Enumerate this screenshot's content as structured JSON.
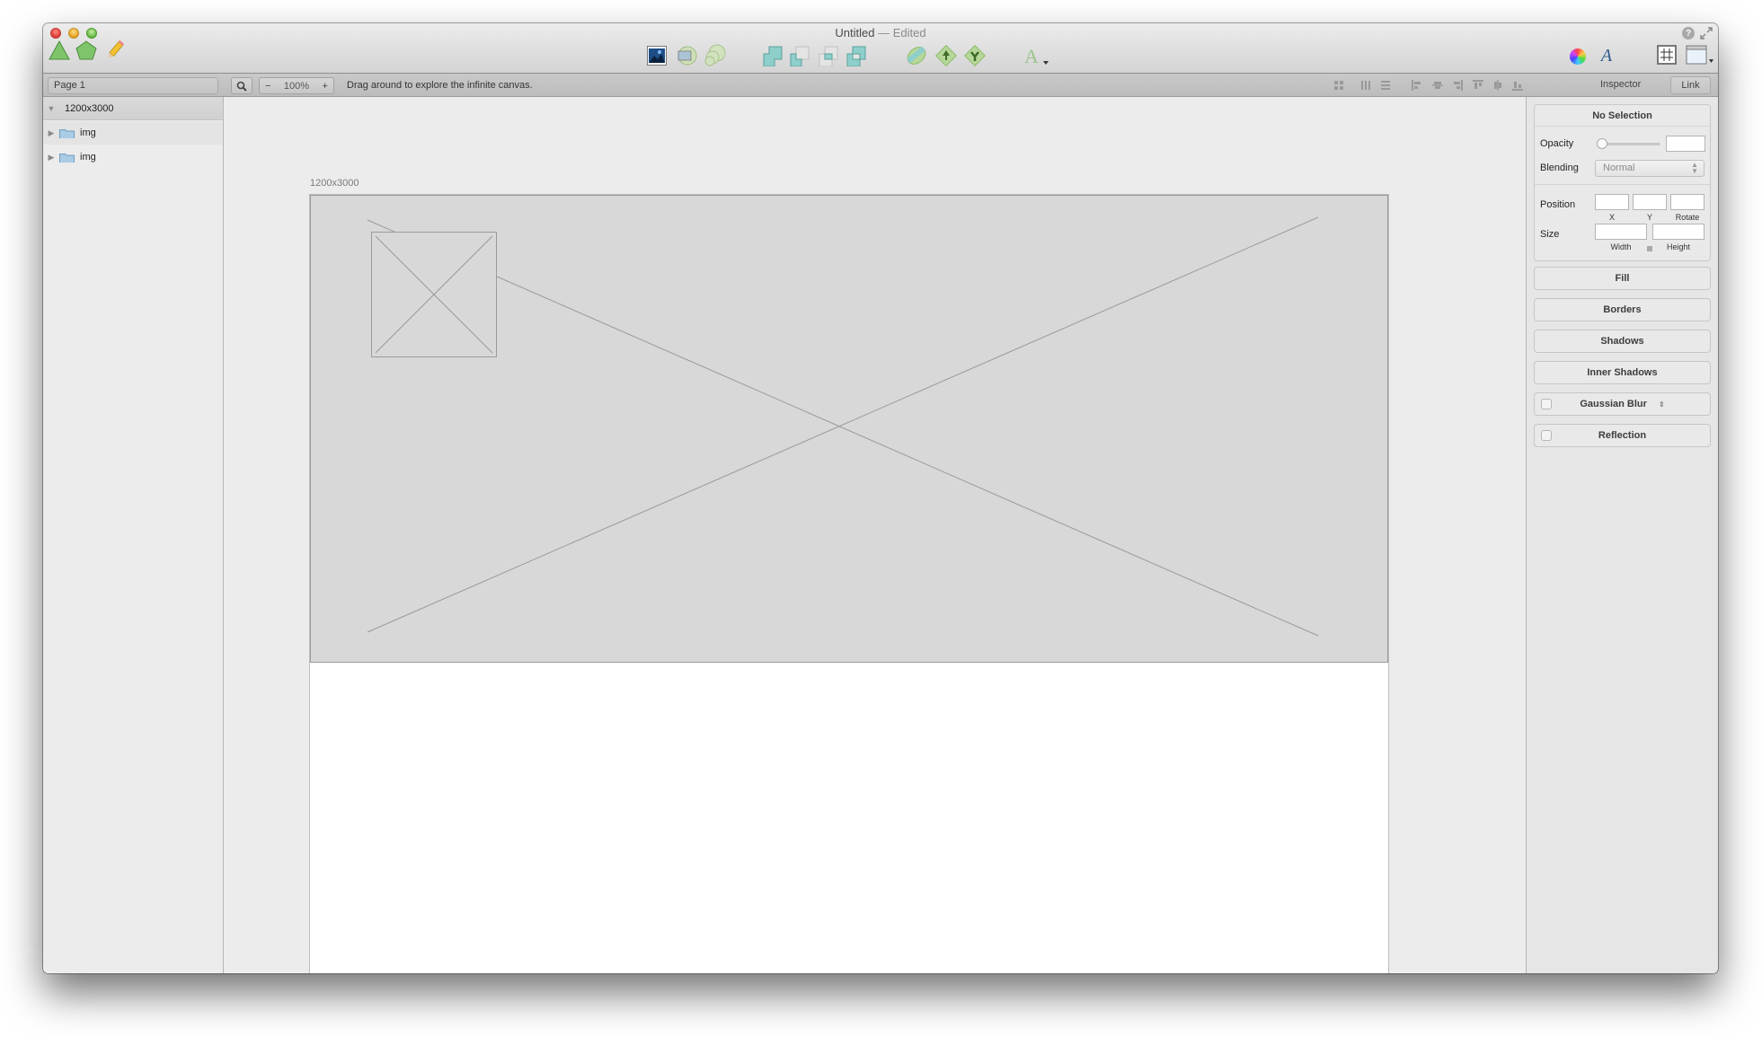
{
  "window": {
    "title": "Untitled",
    "title_separator": " — ",
    "title_status": "Edited"
  },
  "toolbar": {
    "left_tools": [
      {
        "name": "triangle-tool",
        "icon": "triangle-icon"
      },
      {
        "name": "polygon-tool",
        "icon": "pentagon-icon"
      },
      {
        "name": "pencil-tool",
        "icon": "pencil-icon"
      }
    ],
    "center_tools": [
      {
        "name": "image",
        "icon": "image-icon"
      },
      {
        "name": "mask",
        "icon": "mask-icon"
      },
      {
        "name": "scale",
        "icon": "scale-icon"
      },
      {
        "name": "union",
        "icon": "union-icon"
      },
      {
        "name": "subtract",
        "icon": "subtract-icon"
      },
      {
        "name": "intersect",
        "icon": "intersect-icon"
      },
      {
        "name": "difference",
        "icon": "difference-icon"
      },
      {
        "name": "flatten",
        "icon": "flatten-icon"
      },
      {
        "name": "forward",
        "icon": "bring-forward-icon"
      },
      {
        "name": "backward",
        "icon": "send-backward-icon"
      },
      {
        "name": "text",
        "icon": "text-icon"
      }
    ],
    "right_tools": [
      {
        "name": "colors",
        "icon": "color-wheel-icon"
      },
      {
        "name": "fonts",
        "icon": "font-icon"
      },
      {
        "name": "grid",
        "icon": "grid-icon"
      },
      {
        "name": "view",
        "icon": "view-icon"
      }
    ]
  },
  "secondbar": {
    "page_name": "Page 1",
    "zoom_minus": "−",
    "zoom_level": "100%",
    "zoom_plus": "+",
    "hint": "Drag around to explore the infinite canvas.",
    "inspector_tab": "Inspector",
    "link_tab": "Link"
  },
  "layers": {
    "artboard": "1200x3000",
    "items": [
      {
        "label": "img",
        "type": "folder"
      },
      {
        "label": "img",
        "type": "folder"
      }
    ]
  },
  "canvas": {
    "artboard_label": "1200x3000"
  },
  "inspector": {
    "header": "No Selection",
    "opacity_label": "Opacity",
    "opacity_value": "",
    "opacity_slider": 0,
    "blending_label": "Blending",
    "blending_value": "Normal",
    "position_label": "Position",
    "position_sub": [
      "X",
      "Y",
      "Rotate"
    ],
    "size_label": "Size",
    "size_sub": [
      "Width",
      "Height"
    ],
    "sections": [
      {
        "label": "Fill",
        "checkbox": false
      },
      {
        "label": "Borders",
        "checkbox": false
      },
      {
        "label": "Shadows",
        "checkbox": false
      },
      {
        "label": "Inner Shadows",
        "checkbox": false
      },
      {
        "label": "Gaussian Blur",
        "checkbox": true,
        "checked": false,
        "stepper": true
      },
      {
        "label": "Reflection",
        "checkbox": true,
        "checked": false
      }
    ]
  }
}
